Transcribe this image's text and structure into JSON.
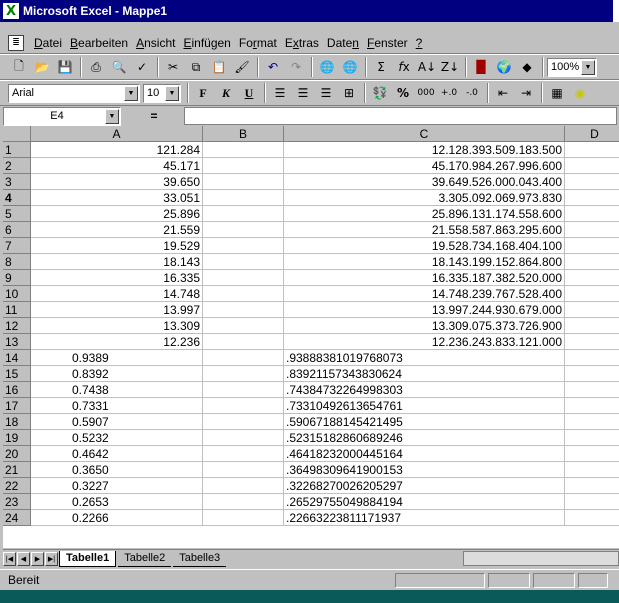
{
  "window": {
    "title": "Microsoft Excel - Mappe1"
  },
  "menu": [
    "Datei",
    "Bearbeiten",
    "Ansicht",
    "Einfügen",
    "Format",
    "Extras",
    "Daten",
    "Fenster",
    "?"
  ],
  "menu_underline": [
    "D",
    "B",
    "A",
    "E",
    "r",
    "x",
    "n",
    "F",
    "?"
  ],
  "toolbar": {
    "zoom": "100%"
  },
  "format_toolbar": {
    "font_name": "Arial",
    "font_size": "10",
    "bold": "F",
    "italic": "K",
    "underline": "U",
    "percent": "%",
    "thousands": "000"
  },
  "formula_bar": {
    "name_box": "E4",
    "equals": "="
  },
  "columns": [
    "A",
    "B",
    "C",
    "D"
  ],
  "rows": [
    {
      "n": "1",
      "a": "121.284",
      "c": "12.128.393.509.183.500"
    },
    {
      "n": "2",
      "a": "45.171",
      "c": "45.170.984.267.996.600"
    },
    {
      "n": "3",
      "a": "39.650",
      "c": "39.649.526.000.043.400"
    },
    {
      "n": "4",
      "a": "33.051",
      "c": "3.305.092.069.973.830"
    },
    {
      "n": "5",
      "a": "25.896",
      "c": "25.896.131.174.558.600"
    },
    {
      "n": "6",
      "a": "21.559",
      "c": "21.558.587.863.295.600"
    },
    {
      "n": "7",
      "a": "19.529",
      "c": "19.528.734.168.404.100"
    },
    {
      "n": "8",
      "a": "18.143",
      "c": "18.143.199.152.864.800"
    },
    {
      "n": "9",
      "a": "16.335",
      "c": "16.335.187.382.520.000"
    },
    {
      "n": "10",
      "a": "14.748",
      "c": "14.748.239.767.528.400"
    },
    {
      "n": "11",
      "a": "13.997",
      "c": "13.997.244.930.679.000"
    },
    {
      "n": "12",
      "a": "13.309",
      "c": "13.309.075.373.726.900"
    },
    {
      "n": "13",
      "a": "12.236",
      "c": "12.236.243.833.121.000"
    },
    {
      "n": "14",
      "a": "0.9389",
      "c": ".93888381019768073"
    },
    {
      "n": "15",
      "a": "0.8392",
      "c": ".83921157343830624"
    },
    {
      "n": "16",
      "a": "0.7438",
      "c": ".74384732264998303"
    },
    {
      "n": "17",
      "a": "0.7331",
      "c": ".73310492613654761"
    },
    {
      "n": "18",
      "a": "0.5907",
      "c": ".59067188145421495"
    },
    {
      "n": "19",
      "a": "0.5232",
      "c": ".52315182860689246"
    },
    {
      "n": "20",
      "a": "0.4642",
      "c": ".46418232000445164"
    },
    {
      "n": "21",
      "a": "0.3650",
      "c": ".36498309641900153"
    },
    {
      "n": "22",
      "a": "0.3227",
      "c": ".32268270026205297"
    },
    {
      "n": "23",
      "a": "0.2653",
      "c": ".26529755049884194"
    },
    {
      "n": "24",
      "a": "0.2266",
      "c": ".22663223811171937"
    }
  ],
  "sheets": [
    "Tabelle1",
    "Tabelle2",
    "Tabelle3"
  ],
  "status": {
    "text": "Bereit"
  }
}
